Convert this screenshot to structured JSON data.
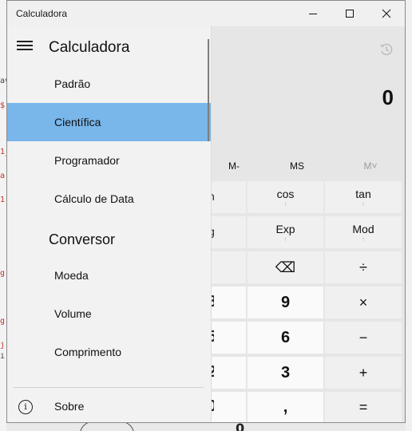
{
  "window": {
    "title": "Calculadora",
    "controls": {
      "minimize": "—",
      "maximize": "☐",
      "close": "✕"
    }
  },
  "display": {
    "value": "0",
    "history_icon": "history-icon"
  },
  "memory": {
    "mminus": "M-",
    "ms": "MS",
    "mview": "M˅"
  },
  "keys": {
    "cos": {
      "label": "cos",
      "sub": "↑"
    },
    "tan": {
      "label": "tan",
      "sub": "↑"
    },
    "exp": {
      "label": "Exp",
      "sub": "↑"
    },
    "mod": {
      "label": "Mod",
      "sub": "↑"
    },
    "backspace": "⌫",
    "divide": "÷",
    "nine": "9",
    "multiply": "×",
    "six": "6",
    "minus": "−",
    "three": "3",
    "plus": "+",
    "decimal": ",",
    "equals": "="
  },
  "partial_keys": {
    "sin_tail": "n",
    "log_tail": "g",
    "eight_tail": "8",
    "five_tail": "5",
    "two_tail": "2",
    "zero_tail": "0"
  },
  "nav": {
    "title": "Calculadora",
    "calc_items": [
      "Padrão",
      "Científica",
      "Programador",
      "Cálculo de Data"
    ],
    "selected_index": 1,
    "converter_header": "Conversor",
    "converter_items": [
      "Moeda",
      "Volume",
      "Comprimento"
    ],
    "about": "Sobre"
  },
  "background": {
    "left_marks": [
      "av",
      "$",
      "1_",
      "a",
      "1",
      "g",
      "g",
      "j",
      "i"
    ],
    "bottom_zero": "0"
  }
}
